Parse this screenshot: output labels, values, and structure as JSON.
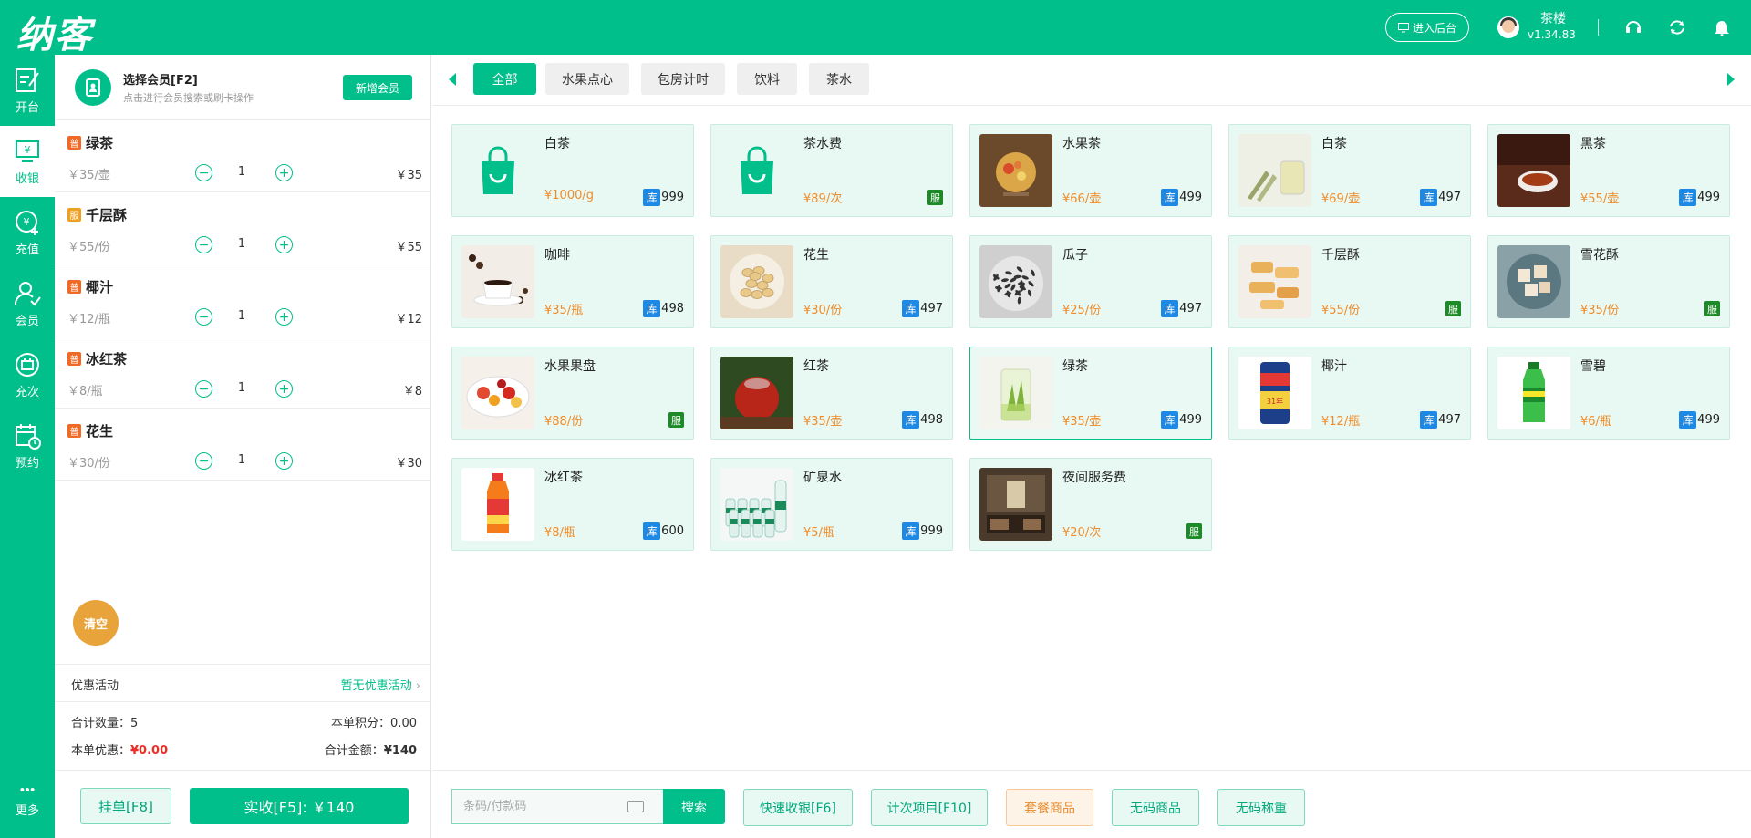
{
  "header": {
    "logo": "纳客",
    "backend_label": "进入后台",
    "user_name": "茶楼",
    "version": "v1.34.83"
  },
  "sidenav": [
    {
      "label": "开台",
      "icon": "edit-table-icon"
    },
    {
      "label": "收银",
      "icon": "cashier-icon"
    },
    {
      "label": "充值",
      "icon": "recharge-icon"
    },
    {
      "label": "会员",
      "icon": "member-icon"
    },
    {
      "label": "充次",
      "icon": "count-card-icon"
    },
    {
      "label": "预约",
      "icon": "calendar-icon"
    },
    {
      "label": "更多",
      "icon": "more-icon"
    }
  ],
  "member": {
    "title": "选择会员[F2]",
    "subtitle": "点击进行会员搜索或刷卡操作",
    "new_member_label": "新增会员"
  },
  "cart": {
    "items": [
      {
        "tag": "普",
        "name": "绿茶",
        "unit_price": "￥35/壶",
        "qty": "1",
        "total": "￥35"
      },
      {
        "tag": "服",
        "name": "千层酥",
        "unit_price": "￥55/份",
        "qty": "1",
        "total": "￥55"
      },
      {
        "tag": "普",
        "name": "椰汁",
        "unit_price": "￥12/瓶",
        "qty": "1",
        "total": "￥12"
      },
      {
        "tag": "普",
        "name": "冰红茶",
        "unit_price": "￥8/瓶",
        "qty": "1",
        "total": "￥8"
      },
      {
        "tag": "普",
        "name": "花生",
        "unit_price": "￥30/份",
        "qty": "1",
        "total": "￥30"
      }
    ],
    "clear_label": "清空",
    "promo_label": "优惠活动",
    "promo_value": "暂无优惠活动",
    "total_qty_label": "合计数量：",
    "total_qty": "5",
    "points_label": "本单积分：",
    "points": "0.00",
    "discount_label": "本单优惠：",
    "discount": "¥0.00",
    "amount_label": "合计金额：",
    "amount": "¥140",
    "hold_label": "挂单[F8]",
    "pay_label": "实收[F5]: ￥140"
  },
  "categories": [
    {
      "label": "全部",
      "active": true
    },
    {
      "label": "水果点心",
      "active": false
    },
    {
      "label": "包房计时",
      "active": false
    },
    {
      "label": "饮料",
      "active": false
    },
    {
      "label": "茶水",
      "active": false
    }
  ],
  "products": [
    {
      "name": "白茶",
      "price": "¥1000/g",
      "stock_label": "库",
      "stock": "999",
      "thumb": "bag-icon"
    },
    {
      "name": "茶水费",
      "price": "¥89/次",
      "service_label": "服",
      "thumb": "bag-icon"
    },
    {
      "name": "水果茶",
      "price": "¥66/壶",
      "stock_label": "库",
      "stock": "499",
      "thumb": "fruit-tea-photo"
    },
    {
      "name": "白茶",
      "price": "¥69/壶",
      "stock_label": "库",
      "stock": "497",
      "thumb": "white-tea-photo"
    },
    {
      "name": "黑茶",
      "price": "¥55/壶",
      "stock_label": "库",
      "stock": "499",
      "thumb": "black-tea-photo"
    },
    {
      "name": "咖啡",
      "price": "¥35/瓶",
      "stock_label": "库",
      "stock": "498",
      "thumb": "coffee-photo"
    },
    {
      "name": "花生",
      "price": "¥30/份",
      "stock_label": "库",
      "stock": "497",
      "thumb": "peanut-photo"
    },
    {
      "name": "瓜子",
      "price": "¥25/份",
      "stock_label": "库",
      "stock": "497",
      "thumb": "seeds-photo"
    },
    {
      "name": "千层酥",
      "price": "¥55/份",
      "service_label": "服",
      "thumb": "pastry-photo"
    },
    {
      "name": "雪花酥",
      "price": "¥35/份",
      "service_label": "服",
      "thumb": "nougat-photo"
    },
    {
      "name": "水果果盘",
      "price": "¥88/份",
      "service_label": "服",
      "thumb": "fruit-plate-photo"
    },
    {
      "name": "红茶",
      "price": "¥35/壶",
      "stock_label": "库",
      "stock": "498",
      "thumb": "red-tea-photo"
    },
    {
      "name": "绿茶",
      "price": "¥35/壶",
      "stock_label": "库",
      "stock": "499",
      "thumb": "green-tea-photo",
      "selected": true
    },
    {
      "name": "椰汁",
      "price": "¥12/瓶",
      "stock_label": "库",
      "stock": "497",
      "thumb": "coconut-can-photo"
    },
    {
      "name": "雪碧",
      "price": "¥6/瓶",
      "stock_label": "库",
      "stock": "499",
      "thumb": "sprite-bottle-photo"
    },
    {
      "name": "冰红茶",
      "price": "¥8/瓶",
      "stock_label": "库",
      "stock": "600",
      "thumb": "ice-tea-bottle-photo"
    },
    {
      "name": "矿泉水",
      "price": "¥5/瓶",
      "stock_label": "库",
      "stock": "999",
      "thumb": "water-pack-photo"
    },
    {
      "name": "夜间服务费",
      "price": "¥20/次",
      "service_label": "服",
      "thumb": "room-photo"
    }
  ],
  "toolbar": {
    "barcode_placeholder": "条码/付款码",
    "search_label": "搜索",
    "quick_cash_label": "快速收银[F6]",
    "count_item_label": "计次项目[F10]",
    "combo_label": "套餐商品",
    "no_code_label": "无码商品",
    "no_code_weigh_label": "无码称重"
  },
  "colors": {
    "brand": "#00bf8a",
    "price": "#f08c2a",
    "stock_badge": "#1e88e5",
    "service_badge": "#1d8a28",
    "clear": "#e8a33a"
  }
}
